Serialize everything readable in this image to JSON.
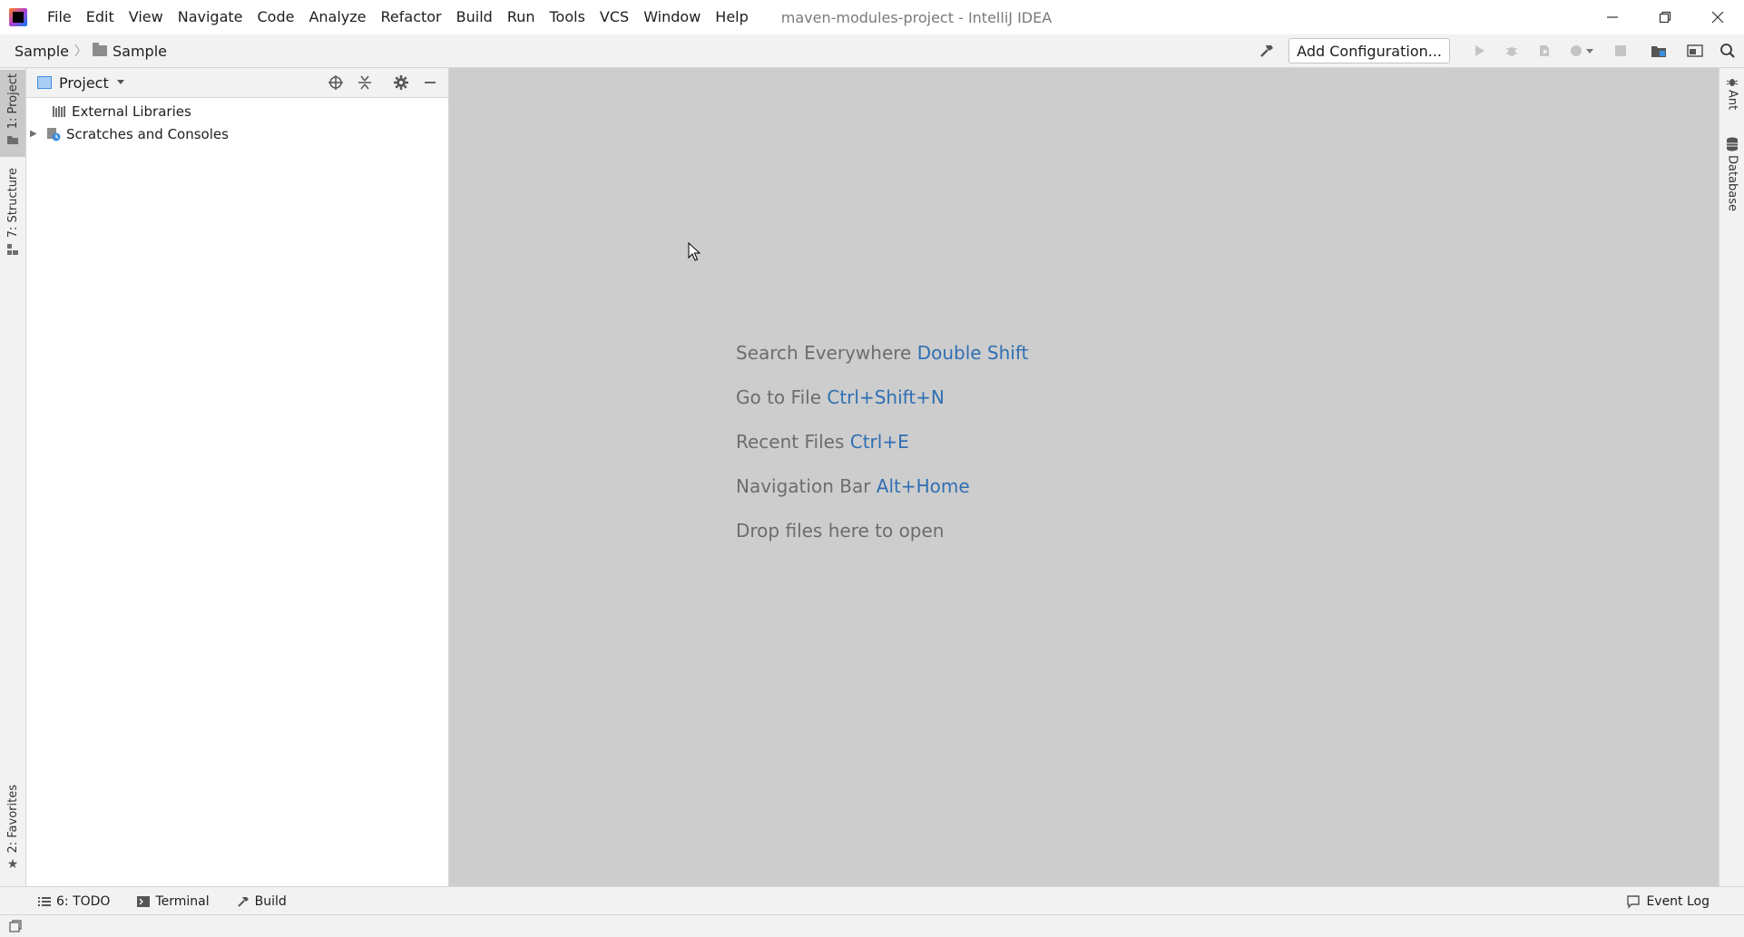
{
  "window": {
    "title": "maven-modules-project - IntelliJ IDEA"
  },
  "menu": {
    "items": [
      "File",
      "Edit",
      "View",
      "Navigate",
      "Code",
      "Analyze",
      "Refactor",
      "Build",
      "Run",
      "Tools",
      "VCS",
      "Window",
      "Help"
    ]
  },
  "breadcrumb": {
    "items": [
      "Sample",
      "Sample"
    ]
  },
  "toolbar": {
    "add_configuration_label": "Add Configuration..."
  },
  "left_stripe": {
    "project_tab": "1: Project",
    "structure_tab": "7: Structure",
    "favorites_tab": "2: Favorites"
  },
  "project_panel": {
    "title": "Project",
    "tree": [
      {
        "label": "External Libraries",
        "icon": "library-icon"
      },
      {
        "label": "Scratches and Consoles",
        "icon": "scratches-icon"
      }
    ]
  },
  "editor": {
    "hints": [
      {
        "text": "Search Everywhere",
        "shortcut": "Double Shift"
      },
      {
        "text": "Go to File",
        "shortcut": "Ctrl+Shift+N"
      },
      {
        "text": "Recent Files",
        "shortcut": "Ctrl+E"
      },
      {
        "text": "Navigation Bar",
        "shortcut": "Alt+Home"
      },
      {
        "text": "Drop files here to open",
        "shortcut": ""
      }
    ]
  },
  "right_stripe": {
    "ant_tab": "Ant",
    "database_tab": "Database"
  },
  "bottom_tools": {
    "todo": "6: TODO",
    "terminal": "Terminal",
    "build": "Build",
    "event_log": "Event Log"
  },
  "colors": {
    "shortcut": "#2f6fb3",
    "editor_bg": "#cdcdcd"
  }
}
